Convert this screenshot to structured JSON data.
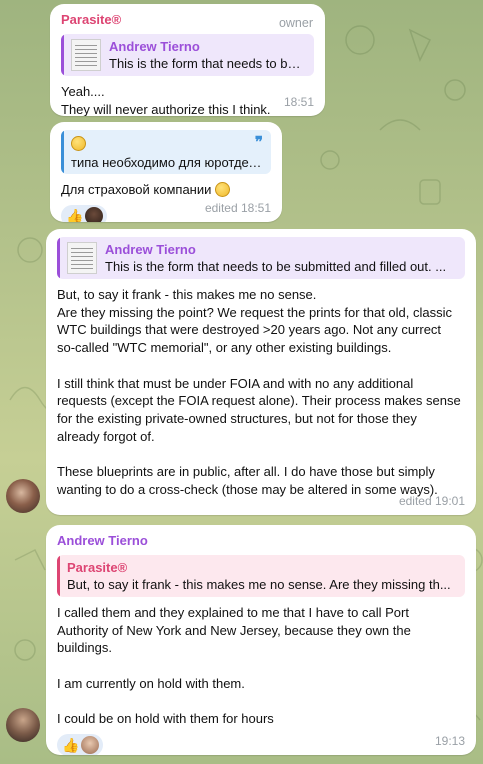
{
  "messages": [
    {
      "sender": "Parasite®",
      "role": "owner",
      "reply": {
        "name": "Andrew Tierno",
        "text": "This is the form that needs to be ..."
      },
      "lines": [
        "Yeah....",
        "They will never authorize this I think."
      ],
      "time": "18:51"
    },
    {
      "reply": {
        "text": "типа необходимо для юротдела"
      },
      "lines": [
        "Для страховой компании"
      ],
      "reaction": "👍",
      "time": "edited 18:51"
    },
    {
      "reply": {
        "name": "Andrew Tierno",
        "text": "This is the form that needs to be submitted and filled out. ..."
      },
      "lines": [
        "But, to say it frank - this makes me no sense.",
        "Are they missing the point? We request the prints for that old, classic",
        "WTC buildings that were destroyed >20 years ago. Not any currect",
        "so-called \"WTC memorial\", or any other existing buildings.",
        "",
        "I still think that must be under FOIA and with no any additional",
        "requests (except the FOIA request alone). Their process makes sense",
        "for the existing private-owned structures, but not for those they",
        "already forgot of.",
        "",
        "These blueprints are in public, after all. I do have those but simply",
        "wanting to do a cross-check (those may be altered in some ways)."
      ],
      "time": "edited 19:01"
    },
    {
      "sender": "Andrew Tierno",
      "reply": {
        "name": "Parasite®",
        "text": "But, to say it frank - this makes me no sense. Are they missing th..."
      },
      "lines": [
        "I called them and they explained to me that I have to call Port",
        "Authority of New York and New Jersey, because they own the",
        "buildings.",
        "",
        "I am currently on hold with them.",
        "",
        "I could be on hold with them for hours"
      ],
      "reaction": "👍",
      "time": "19:13"
    }
  ],
  "colors": {
    "parasite": "#dd4573",
    "andrew": "#9b4fd9",
    "reply_blue": "#3a8fd8"
  }
}
